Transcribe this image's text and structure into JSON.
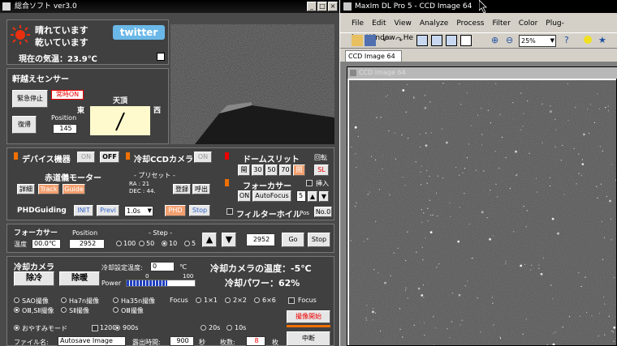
{
  "app": {
    "title": "総合ソフト ver3.0"
  },
  "weather": {
    "line1": "晴れています",
    "line2": "乾いています",
    "temp": "現在の気温：23.9℃",
    "twitter": "twitter"
  },
  "roof": {
    "title": "軒越えセンサー",
    "stop": "緊急停止",
    "always": "常時ON",
    "restore": "復帰",
    "pos_label": "Position",
    "pos_value": "145",
    "zenith": "天頂",
    "east": "東",
    "west": "西"
  },
  "devices": {
    "label": "デバイス機器",
    "on": "ON",
    "off": "OFF",
    "ccd_label": "冷却CCDカメラ",
    "ccd_on": "ON"
  },
  "mount": {
    "title": "赤道儀モーター",
    "detail": "詳細",
    "track": "Track",
    "guide": "Guide",
    "preset": "- プリセット -",
    "ra": "RA : 21",
    "dec": "DEC : 44.",
    "register": "登録",
    "recall": "呼出"
  },
  "dome": {
    "title": "ドームスリット",
    "rotate": "回転",
    "btn_open": "開",
    "b30": "30",
    "b50": "50",
    "b70": "70",
    "btn_stop": "閉",
    "sl": "SL",
    "focuser": "フォーカサー",
    "insert": "挿入",
    "on": "ON",
    "autofocus": "AutoFocus",
    "af_value": "5",
    "filter": "フィルターホイル",
    "pos": "Pos",
    "no": "No.0"
  },
  "phd": {
    "title": "PHDGuiding",
    "init": "INIT",
    "previ": "Previ",
    "exposure": "1.0s",
    "phd": "PHD",
    "stop": "Stop"
  },
  "focuser": {
    "title": "フォーカサー",
    "position_label": "Position",
    "step_label": "- Step -",
    "temp_label": "温度",
    "temp_value": "00.0℃",
    "position_value": "2952",
    "steps": [
      "100",
      "50",
      "10",
      "5"
    ],
    "current": "2952",
    "go": "Go",
    "stop": "Stop"
  },
  "cooling": {
    "title": "冷却カメラ",
    "setpoint_label": "冷却設定温度:",
    "setpoint_value": "0",
    "unit": "℃",
    "power_label": "Power",
    "scale_min": "0",
    "scale_max": "100",
    "power_level": 0.6,
    "cool": "除冷",
    "warm": "除暖",
    "cam_temp": "冷却カメラの温度：-5℃",
    "cam_power": "冷却パワー：62%"
  },
  "capture": {
    "modes": [
      "SAO撮像",
      "Ha7n撮像",
      "Ha35n撮像"
    ],
    "modes2": [
      "OⅢ,SⅡ撮像",
      "SⅡ撮像",
      "OⅢ撮像"
    ],
    "focus_label": "Focus",
    "bin": [
      "1×1",
      "2×2",
      "6×6"
    ],
    "focus_check": "Focus",
    "start": "撮像開始",
    "sleep": "おやすみモード",
    "t1200": "1200s",
    "t900": "900s",
    "t20": "20s",
    "t10": "10s",
    "filename_label": "ファイル名:",
    "filename": "Autosave Image",
    "exposure_label": "露出時間:",
    "exposure_value": "900",
    "exposure_unit": "秒",
    "count_label": "枚数:",
    "count_value": "8",
    "count_unit": "枚",
    "abort": "中断"
  },
  "maxim": {
    "title": "MaxIm DL Pro 5 - CCD Image 64",
    "menu": [
      "File",
      "Edit",
      "View",
      "Analyze",
      "Process",
      "Filter",
      "Color",
      "Plug-in",
      "Window",
      "He"
    ],
    "zoom": "25%",
    "tab": "CCD Image 64",
    "image_title": "CCD Image 64"
  }
}
